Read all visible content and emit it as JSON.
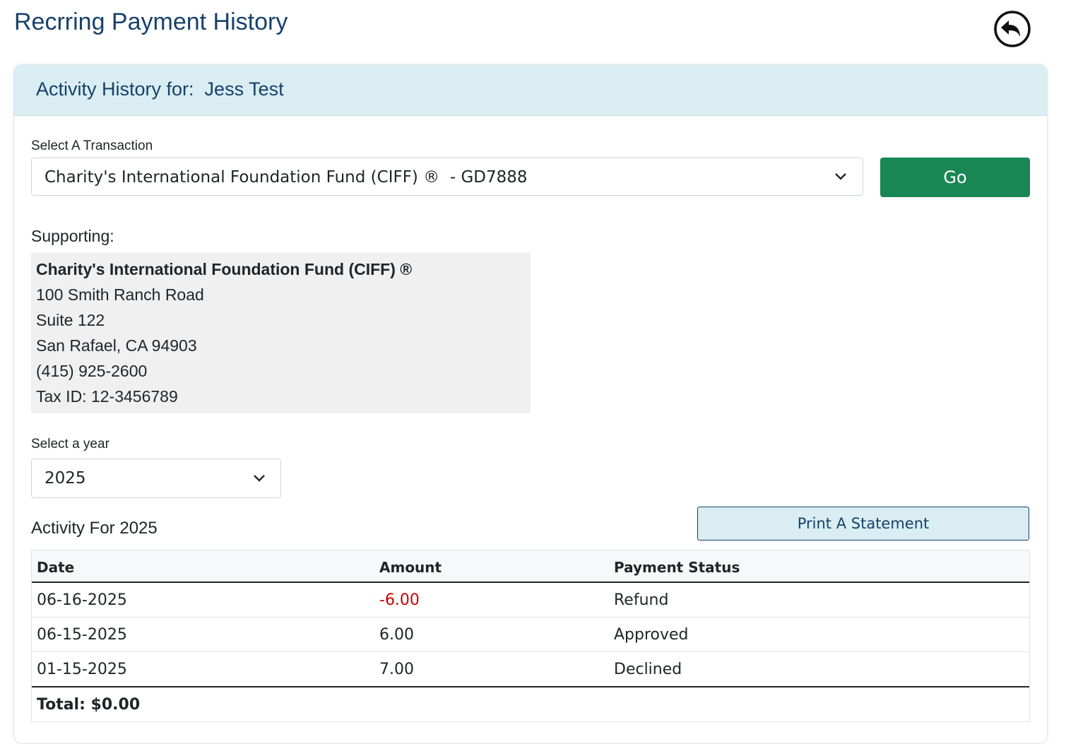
{
  "page": {
    "title": "Recrring Payment History",
    "back_icon": "back-arrow-circle-icon"
  },
  "header": {
    "label": "Activity History for:",
    "name": "Jess Test"
  },
  "transaction": {
    "label": "Select A Transaction",
    "selected": "Charity's International Foundation Fund (CIFF) ®  - GD7888",
    "go_label": "Go"
  },
  "supporting": {
    "label": "Supporting:",
    "org_name": "Charity's International Foundation Fund (CIFF) ®",
    "address1": "100 Smith Ranch Road",
    "address2": "Suite 122",
    "city_state_zip": "San Rafael, CA 94903",
    "phone": "(415) 925-2600",
    "tax_id": "Tax ID: 12-3456789"
  },
  "year": {
    "label": "Select a year",
    "selected": "2025"
  },
  "activity": {
    "title": "Activity For 2025",
    "print_label": "Print A Statement",
    "columns": [
      "Date",
      "Amount",
      "Payment Status"
    ],
    "rows": [
      {
        "date": "06-16-2025",
        "amount": "-6.00",
        "status": "Refund"
      },
      {
        "date": "06-15-2025",
        "amount": "6.00",
        "status": "Approved"
      },
      {
        "date": "01-15-2025",
        "amount": "7.00",
        "status": "Declined"
      }
    ],
    "total": "Total: $0.00"
  },
  "colors": {
    "title": "#17416b",
    "header_bg": "#d9edf2",
    "go_button": "#198754",
    "negative_amount": "#cc0000"
  }
}
